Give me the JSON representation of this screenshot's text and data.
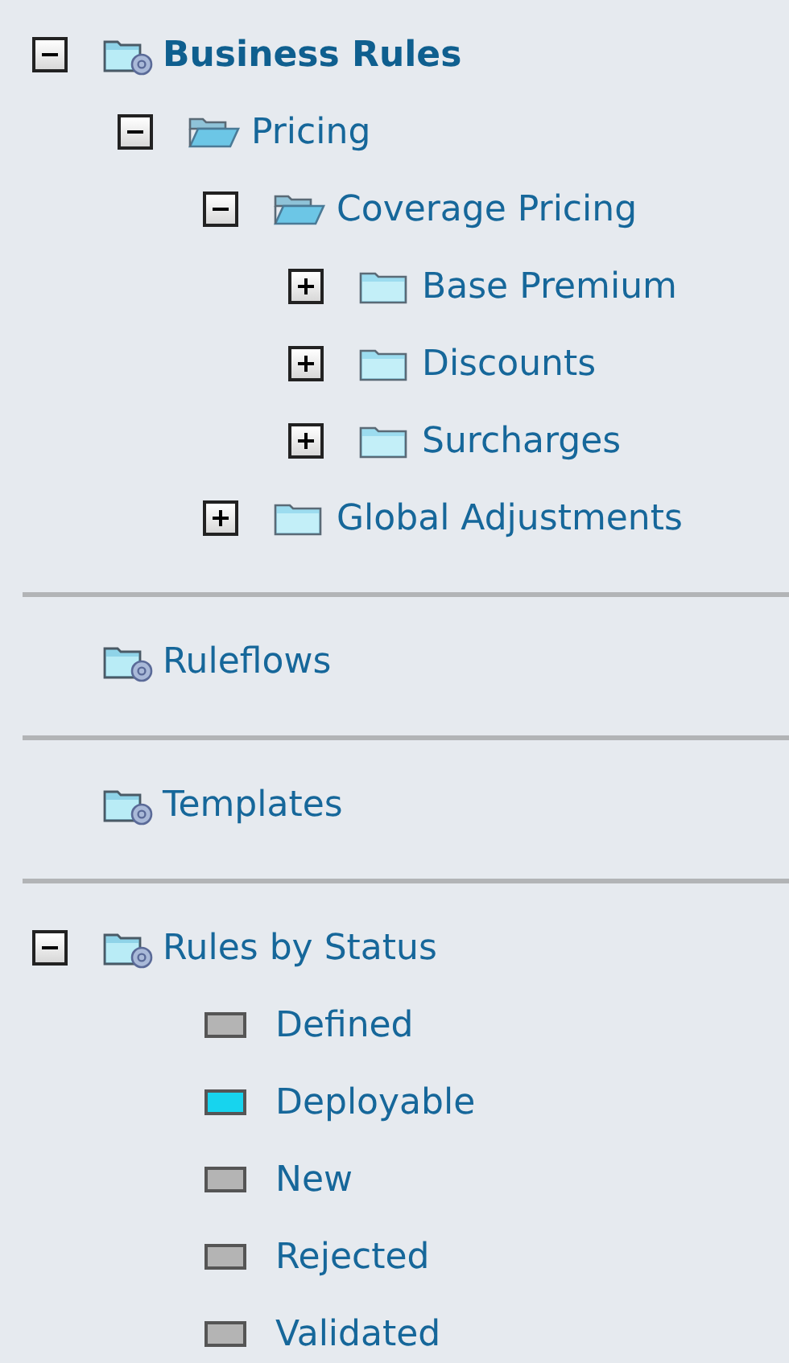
{
  "sections": [
    {
      "tree": [
        {
          "label": "Business Rules",
          "kind": "rule-folder",
          "selected": true,
          "expanded": true,
          "children": [
            {
              "label": "Pricing",
              "kind": "folder",
              "selected": false,
              "expanded": true,
              "children": [
                {
                  "label": "Coverage Pricing",
                  "kind": "folder",
                  "selected": false,
                  "expanded": true,
                  "children": [
                    {
                      "label": "Base Premium",
                      "kind": "folder",
                      "selected": false,
                      "expanded": false
                    },
                    {
                      "label": "Discounts",
                      "kind": "folder",
                      "selected": false,
                      "expanded": false
                    },
                    {
                      "label": "Surcharges",
                      "kind": "folder",
                      "selected": false,
                      "expanded": false
                    }
                  ]
                },
                {
                  "label": "Global Adjustments",
                  "kind": "folder",
                  "selected": false,
                  "expanded": false
                }
              ]
            }
          ]
        }
      ]
    },
    {
      "tree": [
        {
          "label": "Ruleflows",
          "kind": "rule-folder",
          "selected": false
        }
      ]
    },
    {
      "tree": [
        {
          "label": "Templates",
          "kind": "rule-folder",
          "selected": false
        }
      ]
    },
    {
      "tree": [
        {
          "label": "Rules by Status",
          "kind": "rule-folder",
          "selected": false,
          "expanded": true,
          "children": [
            {
              "label": "Defined",
              "kind": "status",
              "selected": false,
              "color": "#b4b4b4"
            },
            {
              "label": "Deployable",
              "kind": "status",
              "selected": false,
              "color": "#17d4ee"
            },
            {
              "label": "New",
              "kind": "status",
              "selected": false,
              "color": "#b4b4b4"
            },
            {
              "label": "Rejected",
              "kind": "status",
              "selected": false,
              "color": "#b4b4b4"
            },
            {
              "label": "Validated",
              "kind": "status",
              "selected": false,
              "color": "#b4b4b4"
            }
          ]
        }
      ]
    }
  ]
}
